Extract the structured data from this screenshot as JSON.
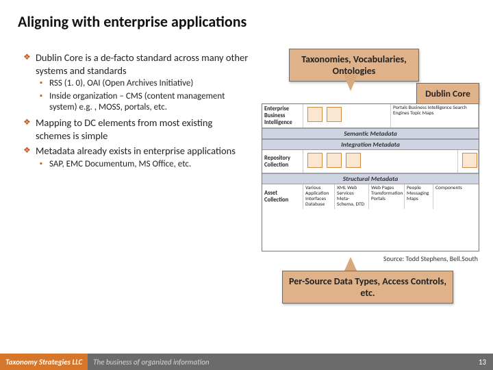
{
  "title": "Aligning with enterprise applications",
  "bullets": {
    "b1": "Dublin Core is a de-facto standard across many other systems and standards",
    "b1a": "RSS (1. 0), OAI (Open Archives Initiative)",
    "b1b": "Inside organization – CMS (content management system) e.g. , MOSS, portals, etc.",
    "b2": "Mapping to DC elements from most existing schemes is simple",
    "b3": "Metadata already exists in enterprise applications",
    "b3a": "SAP, EMC Documentum, MS Office, etc."
  },
  "callouts": {
    "top": "Taxonomies, Vocabularies, Ontologies",
    "dc": "Dublin Core",
    "bottom": "Per-Source Data Types, Access Controls, etc."
  },
  "diagram": {
    "row1_label": "Enterprise Business Intelligence",
    "row1_right": "Portals\nBusiness Intelligence\nSearch Engines\nTopic Maps",
    "hdr1": "Semantic Metadata",
    "hdr2": "Integration Metadata",
    "row2_label": "Repository Collection",
    "hdr3": "Structural Metadata",
    "row3_label": "Asset Collection",
    "row3_c1": "Various Application Interfaces Database",
    "row3_c2": "XML Web Services Meta-Schema, DTD",
    "row3_c3": "Web Pages Transformation Portals",
    "row3_c4": "People Messaging Maps",
    "row3_c5": "Components"
  },
  "source": "Source: Todd Stephens, Bell.South",
  "footer": {
    "brand": "Taxonomy Strategies LLC",
    "tagline": "The business of organized information",
    "page": "13"
  }
}
